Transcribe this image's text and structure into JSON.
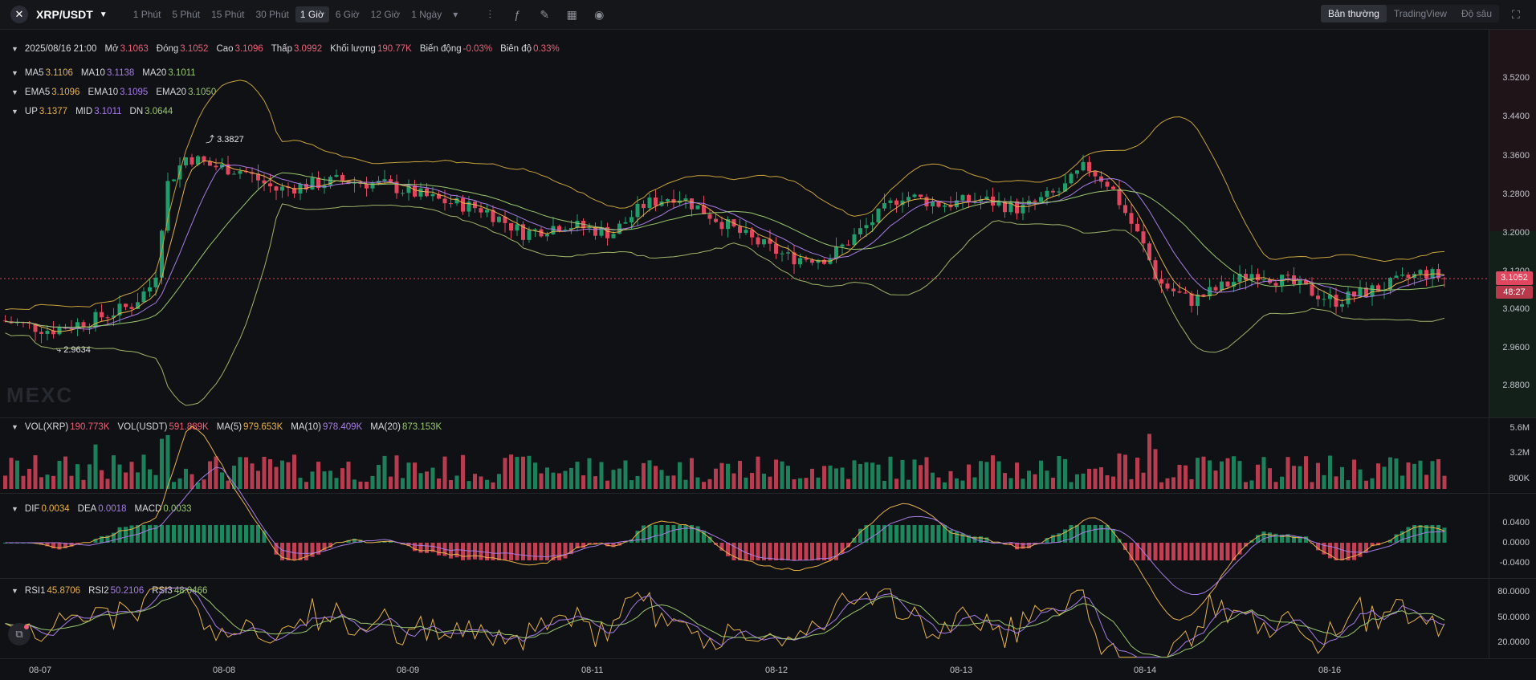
{
  "toolbar": {
    "symbol": "XRP/USDT",
    "intervals": [
      "1 Phút",
      "5 Phút",
      "15 Phút",
      "30 Phút",
      "1 Giờ",
      "6 Giờ",
      "12 Giờ",
      "1 Ngày"
    ],
    "active_interval": "1 Giờ",
    "view_tabs": [
      "Bản thường",
      "TradingView",
      "Độ sâu"
    ],
    "active_view": "Bản thường"
  },
  "ohlc": {
    "date": "2025/08/16 21:00",
    "open_label": "Mở",
    "open": "3.1063",
    "close_label": "Đóng",
    "close": "3.1052",
    "high_label": "Cao",
    "high": "3.1096",
    "low_label": "Thấp",
    "low": "3.0992",
    "volume_label": "Khối lượng",
    "volume": "190.77K",
    "change_label": "Biến động",
    "change": "-0.03%",
    "amplitude_label": "Biên độ",
    "amplitude": "0.33%"
  },
  "ma": {
    "ma5_label": "MA5",
    "ma5": "3.1106",
    "ma10_label": "MA10",
    "ma10": "3.1138",
    "ma20_label": "MA20",
    "ma20": "3.1011"
  },
  "ema": {
    "ema5_label": "EMA5",
    "ema5": "3.1096",
    "ema10_label": "EMA10",
    "ema10": "3.1095",
    "ema20_label": "EMA20",
    "ema20": "3.1050"
  },
  "boll": {
    "up_label": "UP",
    "up": "3.1377",
    "mid_label": "MID",
    "mid": "3.1011",
    "dn_label": "DN",
    "dn": "3.0644"
  },
  "price_axis": [
    "3.5200",
    "3.4400",
    "3.3600",
    "3.2800",
    "3.2000",
    "3.1200",
    "3.0400",
    "2.9600",
    "2.8800"
  ],
  "current_price": "3.1052",
  "countdown": "48:27",
  "peaks": {
    "high": "3.3827",
    "low": "2.9634"
  },
  "watermark": "MEXC",
  "vol": {
    "xrp_label": "VOL(XRP)",
    "xrp": "190.773K",
    "usdt_label": "VOL(USDT)",
    "usdt": "591.889K",
    "ma5_label": "MA(5)",
    "ma5": "979.653K",
    "ma10_label": "MA(10)",
    "ma10": "978.409K",
    "ma20_label": "MA(20)",
    "ma20": "873.153K",
    "axis": [
      "5.6M",
      "3.2M",
      "800K"
    ]
  },
  "macd": {
    "dif_label": "DIF",
    "dif": "0.0034",
    "dea_label": "DEA",
    "dea": "0.0018",
    "macd_label": "MACD",
    "macd": "0.0033",
    "axis": [
      "0.0400",
      "0.0000",
      "-0.0400"
    ]
  },
  "rsi": {
    "rsi1_label": "RSI1",
    "rsi1": "45.8706",
    "rsi2_label": "RSI2",
    "rsi2": "50.2106",
    "rsi3_label": "RSI3",
    "rsi3": "48.0466",
    "axis": [
      "80.0000",
      "50.0000",
      "20.0000"
    ]
  },
  "dates": [
    "08-07",
    "08-08",
    "08-09",
    "08-11",
    "08-12",
    "08-13",
    "08-14",
    "08-16"
  ],
  "colors": {
    "up": "#1f9e6b",
    "down": "#e0475e",
    "ma5": "#e8b24a",
    "ma10": "#a77ce6",
    "ma20": "#9ac86f"
  }
}
